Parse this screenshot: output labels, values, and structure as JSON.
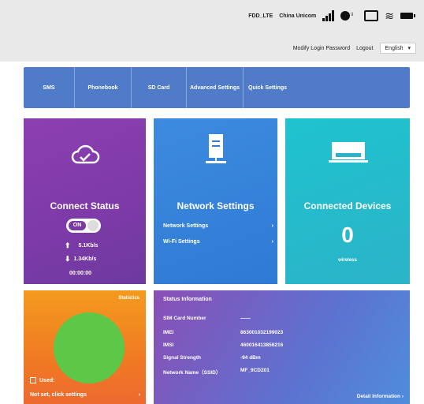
{
  "status_bar": {
    "network_type": "FDD_LTE",
    "carrier": "China Unicom"
  },
  "header_links": {
    "modify_password": "Modify Login Password",
    "logout": "Logout",
    "language": "English"
  },
  "nav": {
    "items": [
      "SMS",
      "Phonebook",
      "SD Card",
      "Advanced Settings",
      "Quick Settings"
    ]
  },
  "connect": {
    "title": "Connect Status",
    "toggle_label": "ON",
    "upload_rate": "5.1Kb/s",
    "download_rate": "1.34Kb/s",
    "duration": "00:00:00"
  },
  "network": {
    "title": "Network Settings",
    "links": [
      "Network Settings",
      "Wi-Fi Settings"
    ]
  },
  "devices": {
    "title": "Connected Devices",
    "count": "0",
    "label": "wireless"
  },
  "stats": {
    "label": "Statistics",
    "used_label": "Used:",
    "settings_link": "Not set, click settings",
    "pie_color": "#5dc847"
  },
  "status_info": {
    "title": "Status Information",
    "rows": [
      {
        "key": "SIM Card Number",
        "value": "——"
      },
      {
        "key": "IMEI",
        "value": "863001032199023"
      },
      {
        "key": "IMSI",
        "value": "460016413856216"
      },
      {
        "key": "Signal Strength",
        "value": "-94 dBm"
      },
      {
        "key": "Network Name（SSID）",
        "value": "MF_9CD201"
      }
    ],
    "detail_link": "Detail Information"
  },
  "colors": {
    "nav": "#4f7bc8",
    "connect_card": "#8c3fb0",
    "network_card": "#3d8be0",
    "devices_card": "#1fc3cf",
    "stats_card": "#f39b1e"
  }
}
